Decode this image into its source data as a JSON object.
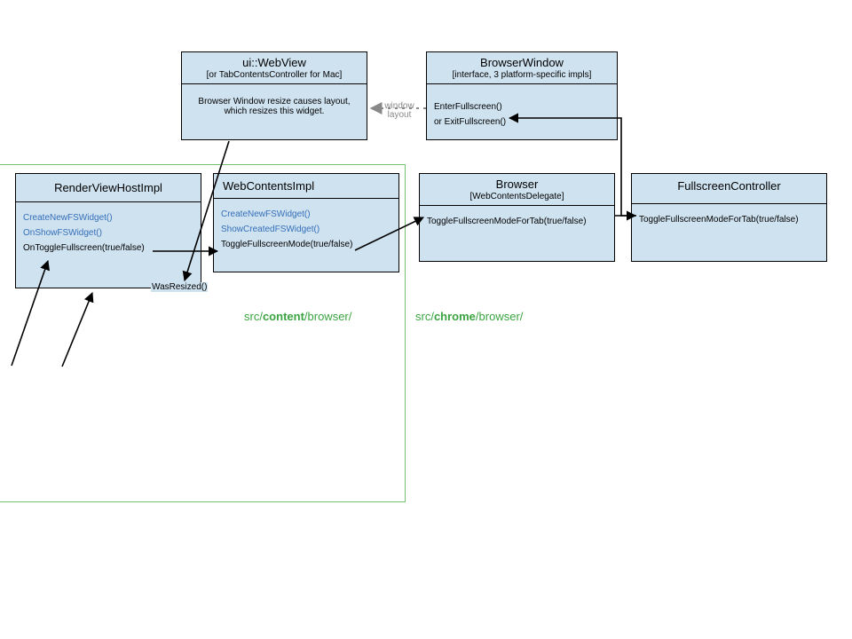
{
  "boxes": {
    "webview": {
      "title": "ui::WebView",
      "subtitle": "[or TabContentsController for Mac]",
      "note": "Browser Window resize causes layout, which resizes this widget."
    },
    "browserwindow": {
      "title": "BrowserWindow",
      "subtitle": "[interface, 3 platform-specific impls]",
      "m1": "EnterFullscreen()",
      "m2": "or ExitFullscreen()"
    },
    "rvh": {
      "title": "RenderViewHostImpl",
      "m1": "CreateNewFSWidget()",
      "m2": "OnShowFSWidget()",
      "m3": "OnToggleFullscreen(true/false)",
      "was": "WasResized()"
    },
    "wci": {
      "title": "WebContentsImpl",
      "m1": "CreateNewFSWidget()",
      "m2": "ShowCreatedFSWidget()",
      "m3": "ToggleFullscreenMode(true/false)"
    },
    "browser": {
      "title": "Browser",
      "subtitle": "[WebContentsDelegate]",
      "m1": "ToggleFullscreenModeForTab(true/false)"
    },
    "fsc": {
      "title": "FullscreenController",
      "m1": "ToggleFullscreenModeForTab(true/false)"
    }
  },
  "labels": {
    "windowlayout1": "window",
    "windowlayout2": "layout",
    "path_content_a": "src/",
    "path_content_b": "content",
    "path_content_c": "/browser/",
    "path_chrome_a": "src/",
    "path_chrome_b": "chrome",
    "path_chrome_c": "/browser/"
  }
}
